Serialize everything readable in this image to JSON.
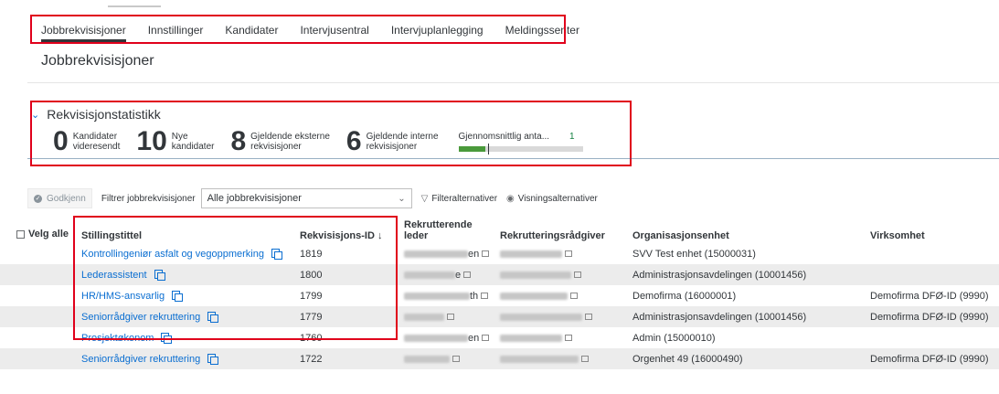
{
  "nav": {
    "tabs": [
      {
        "label": "Jobbrekvisisjoner",
        "active": true
      },
      {
        "label": "Innstillinger",
        "active": false
      },
      {
        "label": "Kandidater",
        "active": false
      },
      {
        "label": "Intervjusentral",
        "active": false
      },
      {
        "label": "Intervjuplanlegging",
        "active": false
      },
      {
        "label": "Meldingssenter",
        "active": false
      }
    ]
  },
  "page": {
    "title": "Jobbrekvisisjoner"
  },
  "stats": {
    "title": "Rekvisisjonstatistikk",
    "items": [
      {
        "num": "0",
        "label1": "Kandidater",
        "label2": "videresendt"
      },
      {
        "num": "10",
        "label1": "Nye",
        "label2": "kandidater"
      },
      {
        "num": "8",
        "label1": "Gjeldende eksterne",
        "label2": "rekvisisjoner"
      },
      {
        "num": "6",
        "label1": "Gjeldende interne",
        "label2": "rekvisisjoner"
      }
    ],
    "average": {
      "label": "Gjennomsnittlig anta...",
      "value": "1",
      "fill_fraction": 0.22,
      "marker_fraction": 0.24
    }
  },
  "toolbar": {
    "approve_label": "Godkjenn",
    "filter_label": "Filtrer jobbrekvisisjoner",
    "filter_value": "Alle jobbrekvisisjoner",
    "filter_options_label": "Filteralternativer",
    "view_options_label": "Visningsalternativer"
  },
  "table": {
    "select_all_label": "Velg alle",
    "headers": {
      "title": "Stillingstittel",
      "req_id": "Rekvisisjons-ID",
      "req_id_sort": "↓",
      "recruiter_leader_1": "Rekrutterende",
      "recruiter_leader_2": "leder",
      "advisor": "Rekrutteringsrådgiver",
      "org_unit": "Organisasjonsenhet",
      "company": "Virksomhet"
    },
    "rows": [
      {
        "title": "Kontrollingeniør asfalt og vegoppmerking",
        "req_id": "1819",
        "leader_suffix": "en",
        "org_unit": "SVV Test enhet (15000031)",
        "company": ""
      },
      {
        "title": "Lederassistent",
        "req_id": "1800",
        "leader_suffix": "e",
        "org_unit": "Administrasjonsavdelingen (10001456)",
        "company": ""
      },
      {
        "title": "HR/HMS-ansvarlig",
        "req_id": "1799",
        "leader_suffix": "th",
        "org_unit": "Demofirma (16000001)",
        "company": "Demofirma DFØ-ID (9990)"
      },
      {
        "title": "Seniorrådgiver rekruttering",
        "req_id": "1779",
        "leader_suffix": "",
        "org_unit": "Administrasjonsavdelingen (10001456)",
        "company": "Demofirma DFØ-ID (9990)"
      },
      {
        "title": "Prosjektøkonom",
        "req_id": "1760",
        "leader_suffix": "en",
        "org_unit": "Admin (15000010)",
        "company": ""
      },
      {
        "title": "Seniorrådgiver rekruttering",
        "req_id": "1722",
        "leader_suffix": "",
        "org_unit": "Orgenhet 49 (16000490)",
        "company": "Demofirma DFØ-ID (9990)"
      }
    ]
  },
  "colors": {
    "accent": "#0a6ed1",
    "highlight": "#e0001b",
    "progress": "#4a9a3b",
    "row_alt": "#ececec"
  }
}
